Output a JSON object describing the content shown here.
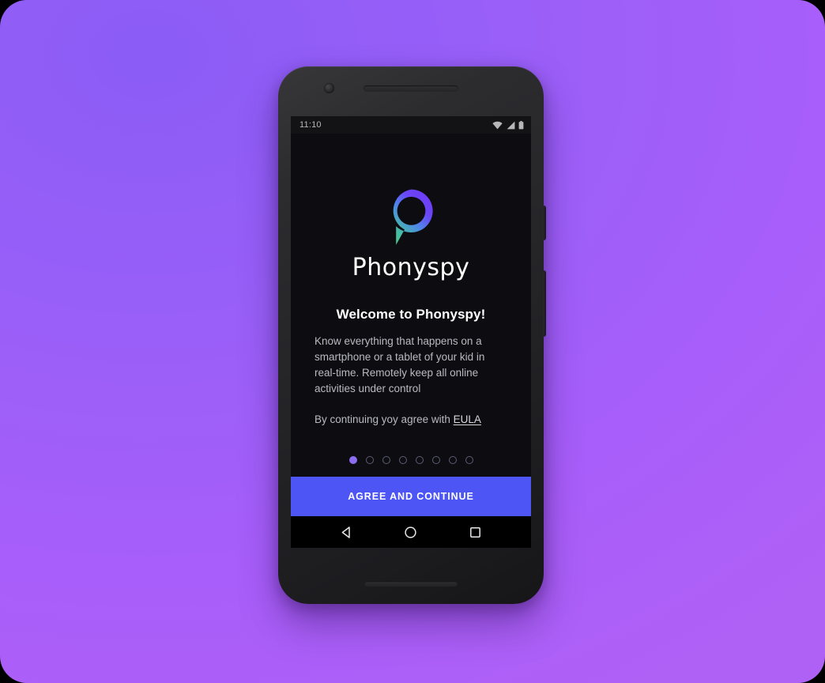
{
  "background": {
    "gradient_from": "#8b5cf6",
    "gradient_to": "#b061f5"
  },
  "device": {
    "name": "android-phone-mockup",
    "frame_color": "#242427"
  },
  "status_bar": {
    "time": "11:10",
    "icons": [
      "wifi-icon",
      "cellular-signal-icon",
      "battery-icon"
    ]
  },
  "app": {
    "screen_background": "#0d0d11",
    "logo": {
      "icon_name": "phonyspy-speech-bubble-logo",
      "gradient_start": "#7a43f5",
      "gradient_mid": "#4f7ef0",
      "gradient_end": "#45c69c"
    },
    "brand_name": "Phonyspy",
    "title": "Welcome to Phonyspy!",
    "body": "Know everything that happens on a smartphone or a tablet of your kid in real-time. Remotely keep all online activities under control",
    "eula_prefix": "By continuing yoy agree with ",
    "eula_link_label": "EULA",
    "pagination": {
      "total": 8,
      "active_index": 0,
      "active_color": "#8b6ef0",
      "inactive_color": "#5c5c75"
    },
    "cta": {
      "label": "AGREE AND CONTINUE",
      "color": "#4d56f5"
    }
  },
  "nav_bar": {
    "back_label": "back-icon",
    "home_label": "home-icon",
    "recents_label": "recents-icon"
  }
}
